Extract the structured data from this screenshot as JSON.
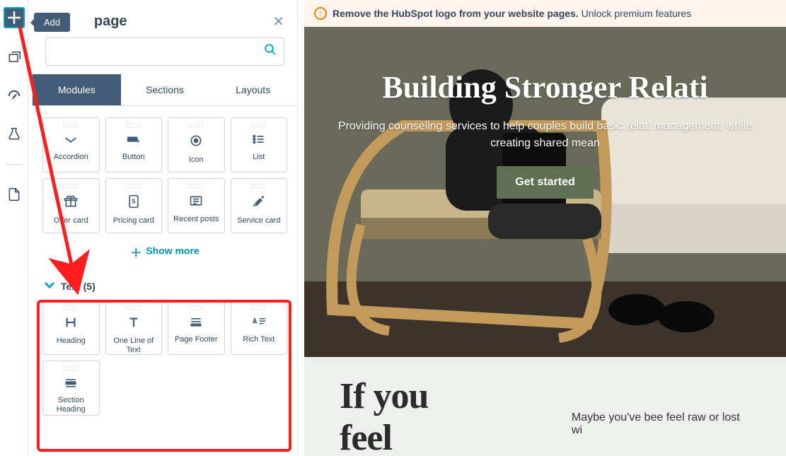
{
  "rail": {
    "add_tooltip": "Add"
  },
  "panel": {
    "title_suffix": " page",
    "tabs": {
      "modules": "Modules",
      "sections": "Sections",
      "layouts": "Layouts"
    },
    "modules_group1": [
      {
        "label": "Accordion"
      },
      {
        "label": "Button"
      },
      {
        "label": "Icon"
      },
      {
        "label": "List"
      },
      {
        "label": "Offer card"
      },
      {
        "label": "Pricing card"
      },
      {
        "label": "Recent posts"
      },
      {
        "label": "Service card"
      }
    ],
    "show_more": "Show more",
    "text_group_title": "Text (5)",
    "text_modules": [
      {
        "label": "Heading"
      },
      {
        "label": "One Line of Text"
      },
      {
        "label": "Page Footer"
      },
      {
        "label": "Rich Text"
      },
      {
        "label": "Section Heading"
      }
    ]
  },
  "banner": {
    "bold": "Remove the HubSpot logo from your website pages.",
    "rest": " Unlock premium features"
  },
  "hero": {
    "title": "Building Stronger Relati",
    "subtitle": "Providing counseling services to help couples build basic relati management, while creating shared mean",
    "cta": "Get started"
  },
  "section2": {
    "headline": "If you feel",
    "body": "Maybe you've bee feel raw or lost wi"
  }
}
